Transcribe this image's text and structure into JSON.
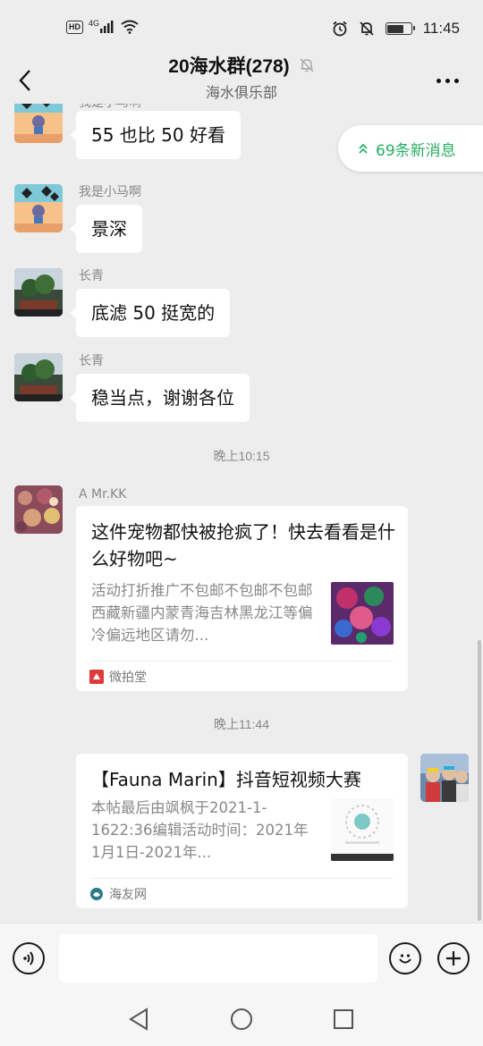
{
  "status_bar": {
    "hd": "HD",
    "network": "4G",
    "time": "11:45",
    "battery_level": 0.7
  },
  "header": {
    "title": "20海水群(278)",
    "subtitle": "海水俱乐部"
  },
  "new_messages": {
    "label": "69条新消息"
  },
  "messages": [
    {
      "sender": "我是小马啊",
      "text": "55 也比 50 好看"
    },
    {
      "sender": "我是小马啊",
      "text": "景深"
    },
    {
      "sender": "长青",
      "text": "底滤 50 挺宽的"
    },
    {
      "sender": "长青",
      "text": "稳当点，谢谢各位"
    }
  ],
  "timestamps": [
    "晚上10:15",
    "晚上11:44"
  ],
  "card1": {
    "sender": "A  Mr.KK",
    "title": "这件宠物都快被抢疯了！快去看看是什么好物吧~",
    "description": "活动打折推广不包邮不包邮不包邮西藏新疆内蒙青海吉林黑龙江等偏冷偏远地区请勿...",
    "source": "微拍堂"
  },
  "card2": {
    "title": "【Fauna Marin】抖音短视频大赛",
    "description": "本帖最后由飒枫于2021-1-1622:36编辑活动时间：2021年1月1日-2021年...",
    "source": "海友网"
  },
  "colors": {
    "background": "#ededed",
    "accent_green": "#2aae67",
    "bubble": "#ffffff"
  },
  "icons": [
    "back-icon",
    "mute-bell-icon",
    "more-icon",
    "double-chevron-up-icon",
    "voice-icon",
    "emoji-icon",
    "plus-icon",
    "back-triangle-icon",
    "home-circle-icon",
    "recents-square-icon"
  ]
}
